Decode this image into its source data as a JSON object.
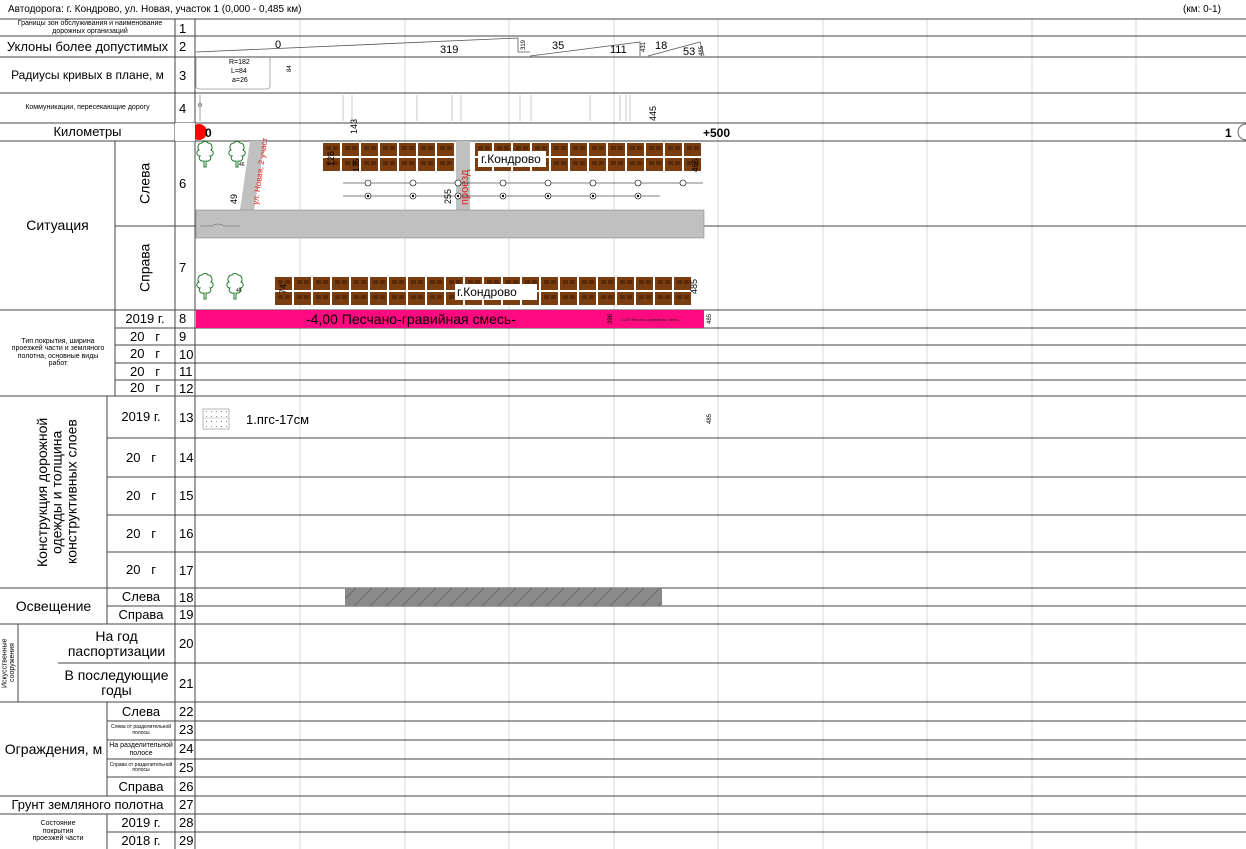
{
  "header": {
    "title": "Автодорога: г. Кондрово, ул. Новая, участок 1 (0,000 - 0,485 км)",
    "range": "(км: 0-1)"
  },
  "rows": {
    "r1": "Границы зон обслуживания и наименование дорожных организаций",
    "r2": "Уклоны более допустимых",
    "r3": "Радиусы кривых в плане, м",
    "r4": "Коммуникации, пересекающие дорогу",
    "r5": "Километры",
    "situation": "Ситуация",
    "left": "Слева",
    "right": "Справа",
    "surface": "Тип покрытия, ширина проезжей части и земляного полотна, основные виды работ",
    "construction": "Конструкция дорожной одежды и толщина конструктивных слоев",
    "lighting": "Освещение",
    "structures": "Искусственные сооружения",
    "passport_year": "На год паспортизации",
    "later_years": "В последующие годы",
    "fences": "Ограждения, м",
    "left_of_divider": "Слева от разделительной полосы",
    "on_divider": "На разделительной полосе",
    "right_of_divider": "Справа от разделительной полосы",
    "soil": "Грунт земляного полотна",
    "condition": "Состояние покрытия проезжей части",
    "y2019": "2019 г.",
    "y2018": "2018 г.",
    "y20": "20   г"
  },
  "numbers": [
    "1",
    "2",
    "3",
    "4",
    "5",
    "6",
    "7",
    "8",
    "9",
    "10",
    "11",
    "12",
    "13",
    "14",
    "15",
    "16",
    "17",
    "18",
    "19",
    "20",
    "21",
    "22",
    "23",
    "24",
    "25",
    "26",
    "27",
    "28",
    "29"
  ],
  "plot": {
    "slopes": [
      "0",
      "319",
      "319",
      "35",
      "111",
      "431",
      "18",
      "53",
      "485"
    ],
    "curve": [
      "R=182",
      "L=84",
      "a=26",
      "84"
    ],
    "communications_mark": "445",
    "km_marks": [
      "0",
      "143",
      "+500",
      "1"
    ],
    "situation_left": [
      "126",
      "г.Кондрово",
      "135",
      "465",
      "49",
      "ул. Новая, 2 участ",
      "255",
      "проезд"
    ],
    "situation_right": [
      "74",
      "г.Кондрово",
      "485"
    ],
    "surface_text": "-4,00 Песчано-гравийная смесь-",
    "surface_small": "-4,00 Песчано-гравийная смесь-",
    "surface_marks": [
      "396",
      "485"
    ],
    "construction_text": "1.пгс-17см",
    "construction_mark": "485"
  },
  "colors": {
    "surface": "#ff0a80",
    "building": "#7a3d10",
    "road": "#c0c0c0",
    "km_marker": "#ff0000",
    "lighting": "#808080",
    "street": "#e02020"
  }
}
